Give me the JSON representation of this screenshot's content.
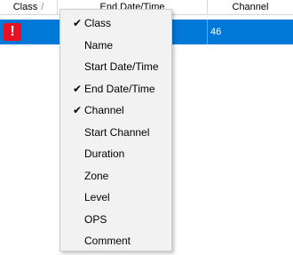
{
  "header": {
    "class_label": "Class",
    "class_sort_glyph": "/",
    "end_label": "End Date/Time",
    "channel_label": "Channel"
  },
  "row": {
    "alert_glyph": "!",
    "channel_value": "46"
  },
  "context_menu": {
    "items": [
      {
        "label": "Class",
        "checked": true,
        "check_glyph": "✔"
      },
      {
        "label": "Name",
        "checked": false,
        "check_glyph": ""
      },
      {
        "label": "Start Date/Time",
        "checked": false,
        "check_glyph": ""
      },
      {
        "label": "End Date/Time",
        "checked": true,
        "check_glyph": "✔"
      },
      {
        "label": "Channel",
        "checked": true,
        "check_glyph": "✔"
      },
      {
        "label": "Start Channel",
        "checked": false,
        "check_glyph": ""
      },
      {
        "label": "Duration",
        "checked": false,
        "check_glyph": ""
      },
      {
        "label": "Zone",
        "checked": false,
        "check_glyph": ""
      },
      {
        "label": "Level",
        "checked": false,
        "check_glyph": ""
      },
      {
        "label": "OPS",
        "checked": false,
        "check_glyph": ""
      },
      {
        "label": "Comment",
        "checked": false,
        "check_glyph": ""
      }
    ]
  },
  "colors": {
    "selection": "#0078d7",
    "alert": "#e81123",
    "menu_background": "#f2f2f2"
  },
  "icons": {
    "alert": "exclamation-icon",
    "check": "checkmark-icon"
  }
}
